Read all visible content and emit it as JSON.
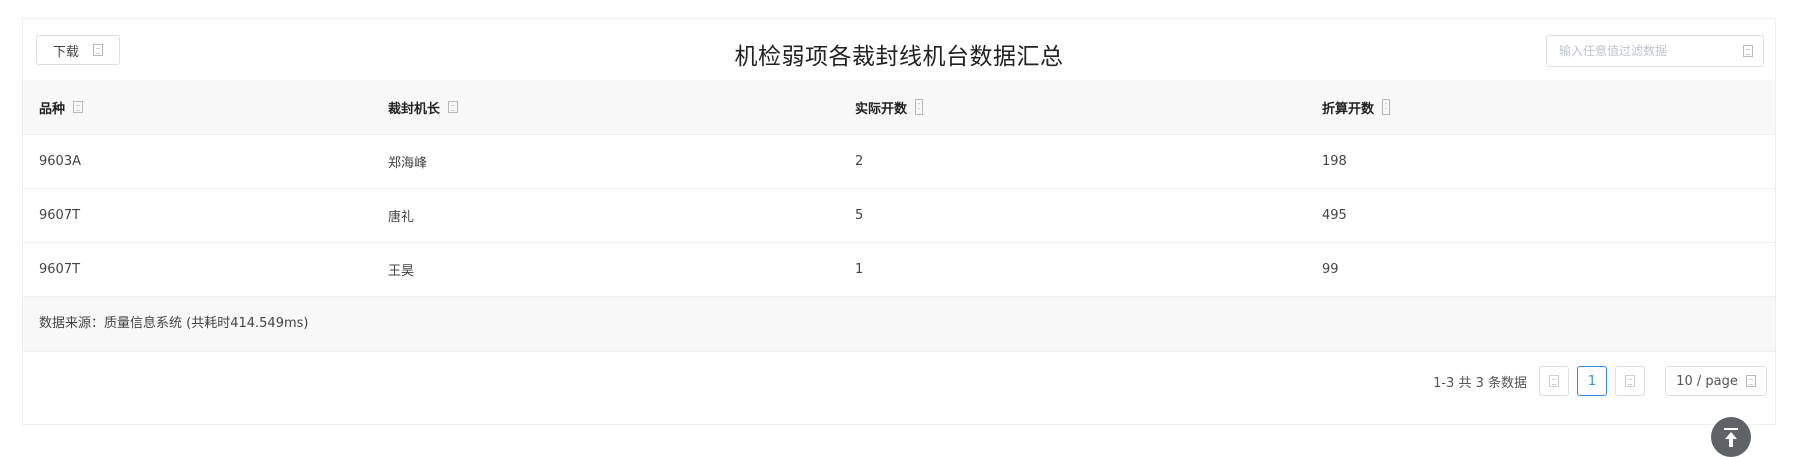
{
  "toolbar": {
    "download_label": "下载",
    "title": "机检弱项各裁封线机台数据汇总",
    "search_placeholder": "输入任意值过滤数据"
  },
  "table": {
    "columns": [
      "品种",
      "裁封机长",
      "实际开数",
      "折算开数"
    ],
    "rows": [
      [
        "9603A",
        "郑海峰",
        "2",
        "198"
      ],
      [
        "9607T",
        "唐礼",
        "5",
        "495"
      ],
      [
        "9607T",
        "王昊",
        "1",
        "99"
      ]
    ],
    "footer_note": "数据来源：质量信息系统 (共耗时414.549ms)"
  },
  "pagination": {
    "total_text": "1-3 共 3 条数据",
    "current_page": "1",
    "page_size": "10 / page"
  },
  "colors": {
    "accent": "#2d8cf0",
    "header_bg": "#f8f8f9",
    "border": "#ebeef5"
  },
  "icons": {
    "download": "table-export-icon",
    "search": "filter-icon",
    "sort": "sort-icon",
    "back_to_top": "arrow-up-icon"
  }
}
